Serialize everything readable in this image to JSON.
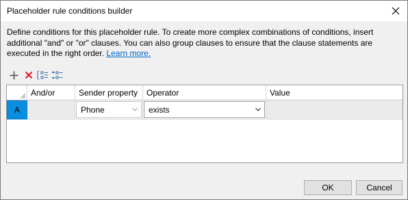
{
  "window": {
    "title": "Placeholder rule conditions builder"
  },
  "description": {
    "text": "Define conditions for this placeholder rule. To create more complex combinations of conditions, insert additional \"and\" or \"or\" clauses. You can also group clauses to ensure that the clause statements are executed in the right order.",
    "link": "Learn more."
  },
  "toolbar": {
    "icons": [
      "add-icon",
      "delete-icon",
      "group-clauses-icon",
      "move-clause-icon"
    ]
  },
  "grid": {
    "columns": [
      "And/or",
      "Sender property",
      "Operator",
      "Value"
    ],
    "rows": [
      {
        "label": "A",
        "and_or": "",
        "sender_property": "Phone",
        "operator": "exists",
        "value": ""
      }
    ]
  },
  "buttons": {
    "ok": "OK",
    "cancel": "Cancel"
  },
  "colors": {
    "selected_row_header": "#0a8ee0",
    "link": "#0066cc",
    "delete_icon": "#e81123"
  }
}
